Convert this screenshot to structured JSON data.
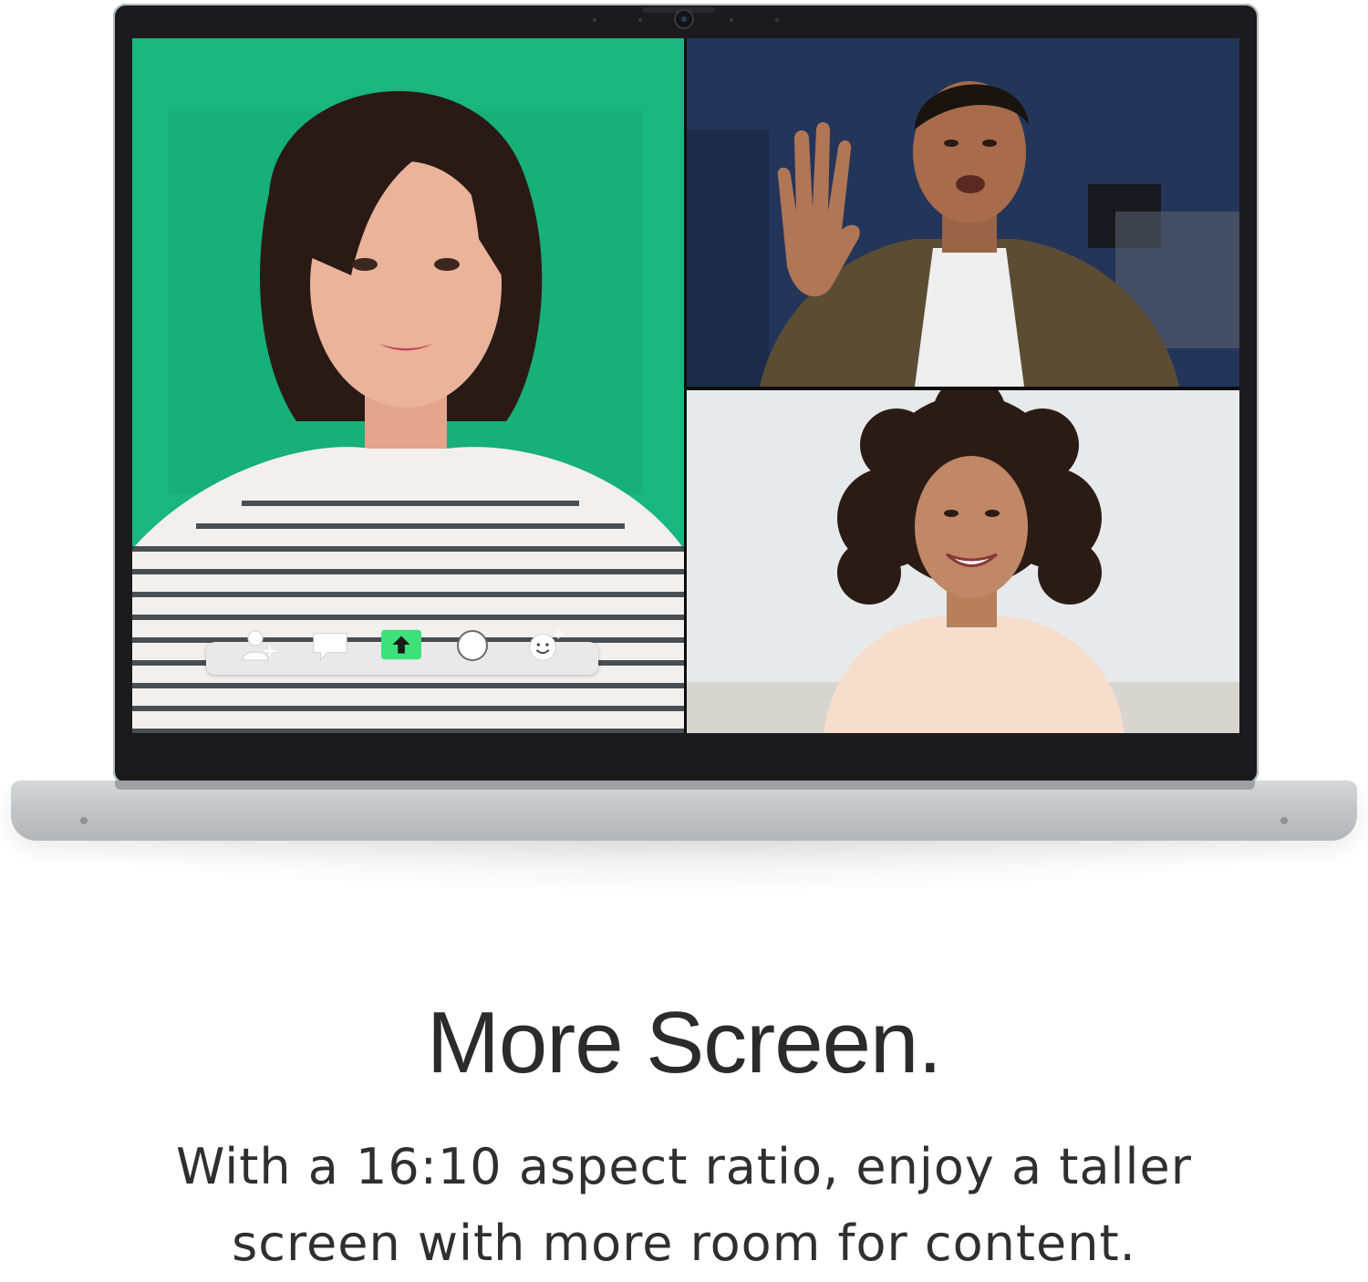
{
  "hero": {
    "title": "More Screen.",
    "description": "With a 16:10 aspect ratio, enjoy a taller screen with more room for content."
  },
  "video_call": {
    "participants": [
      {
        "tile": "main",
        "background": "#18b47e"
      },
      {
        "tile": "top-right",
        "background": "#2a3f6c"
      },
      {
        "tile": "bottom-right",
        "background": "#e6e8e9"
      }
    ],
    "toolbar": {
      "buttons": [
        {
          "icon": "add-person-icon"
        },
        {
          "icon": "chat-icon"
        },
        {
          "icon": "share-screen-icon",
          "accent": "#3ee07a"
        },
        {
          "icon": "record-icon"
        },
        {
          "icon": "add-reaction-icon"
        }
      ]
    }
  },
  "colors": {
    "laptop_body": "#c6c7c9",
    "bezel": "#1b1b1d",
    "text": "#2b2b2b",
    "share_accent": "#3ee07a"
  }
}
